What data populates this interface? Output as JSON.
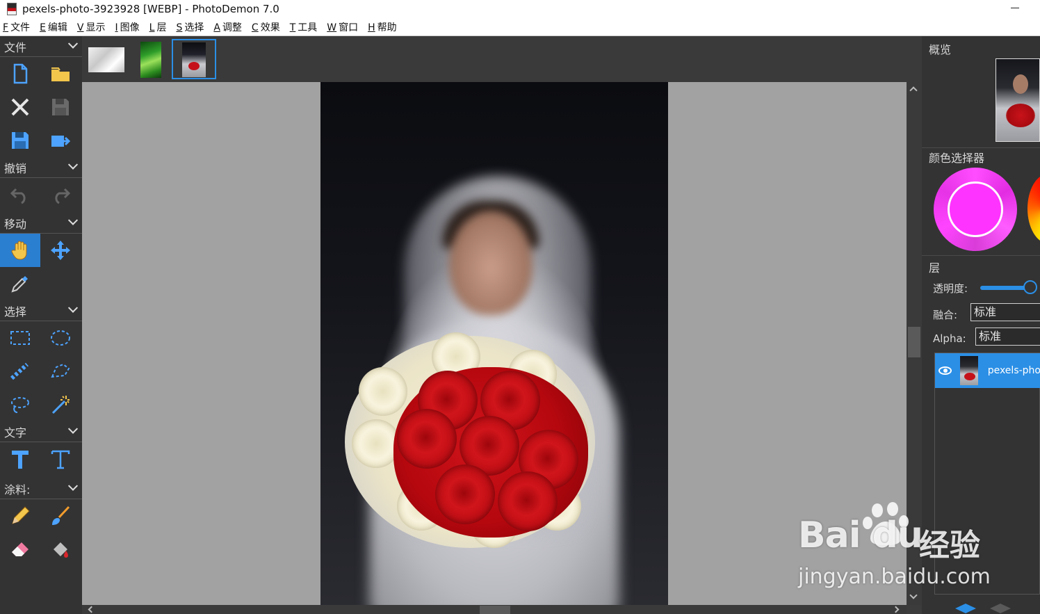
{
  "window": {
    "title": "pexels-photo-3923928 [WEBP]  -  PhotoDemon 7.0"
  },
  "menu": [
    {
      "key": "F",
      "label": "文件"
    },
    {
      "key": "E",
      "label": "编辑"
    },
    {
      "key": "V",
      "label": "显示"
    },
    {
      "key": "I",
      "label": "图像"
    },
    {
      "key": "L",
      "label": "层"
    },
    {
      "key": "S",
      "label": "选择"
    },
    {
      "key": "A",
      "label": "调整"
    },
    {
      "key": "C",
      "label": "效果"
    },
    {
      "key": "T",
      "label": "工具"
    },
    {
      "key": "W",
      "label": "窗口"
    },
    {
      "key": "H",
      "label": "帮助"
    }
  ],
  "toolbox": {
    "file": "文件",
    "undo": "撤销",
    "move": "移动",
    "select": "选择",
    "text": "文字",
    "paint": "涂料:"
  },
  "right_panel": {
    "overview": "概览",
    "color_picker": "颜色选择器",
    "layers": "层",
    "opacity_label": "透明度:",
    "opacity_value": 1.0,
    "blend_label": "融合:",
    "blend_value": "标准",
    "alpha_label": "Alpha:",
    "alpha_value": "标准",
    "layer_name": "pexels-pho"
  },
  "colors": {
    "accent": "#2b8fe6",
    "picked": "#ff33ff"
  },
  "watermark": {
    "logo": "Bai du",
    "suffix": "经验",
    "url": "jingyan.baidu.com"
  }
}
